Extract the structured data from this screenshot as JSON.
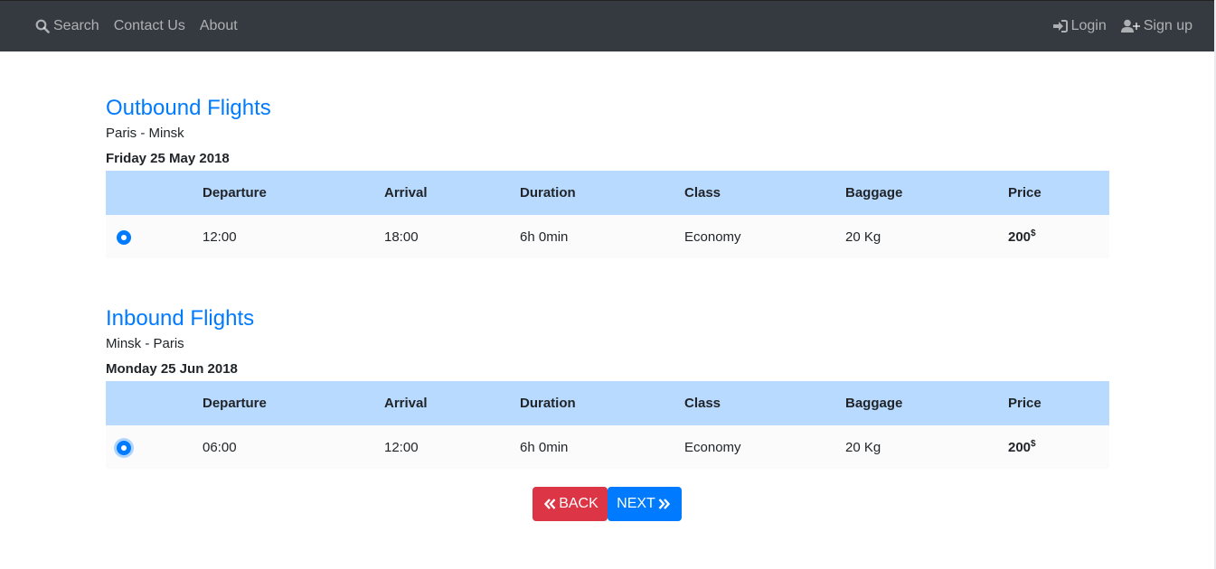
{
  "nav": {
    "left": [
      {
        "label": "Search",
        "icon": "search-icon"
      },
      {
        "label": "Contact Us"
      },
      {
        "label": "About"
      }
    ],
    "right": [
      {
        "label": "Login",
        "icon": "sign-in-icon"
      },
      {
        "label": "Sign up",
        "icon": "user-plus-icon"
      }
    ]
  },
  "columns": [
    "Departure",
    "Arrival",
    "Duration",
    "Class",
    "Baggage",
    "Price"
  ],
  "outbound": {
    "title": "Outbound Flights",
    "route": "Paris - Minsk",
    "date": "Friday 25 May 2018",
    "rows": [
      {
        "departure": "12:00",
        "arrival": "18:00",
        "duration": "6h 0min",
        "class": "Economy",
        "baggage": "20 Kg",
        "price": "200",
        "currency": "$",
        "selected": true
      }
    ]
  },
  "inbound": {
    "title": "Inbound Flights",
    "route": "Minsk - Paris",
    "date": "Monday 25 Jun 2018",
    "rows": [
      {
        "departure": "06:00",
        "arrival": "12:00",
        "duration": "6h 0min",
        "class": "Economy",
        "baggage": "20 Kg",
        "price": "200",
        "currency": "$",
        "selected": true
      }
    ]
  },
  "actions": {
    "back_label": "BACK",
    "next_label": "NEXT"
  },
  "colors": {
    "navbar": "#343a40",
    "accent": "#007bff",
    "danger": "#dc3545",
    "table_header": "#b8daff"
  }
}
